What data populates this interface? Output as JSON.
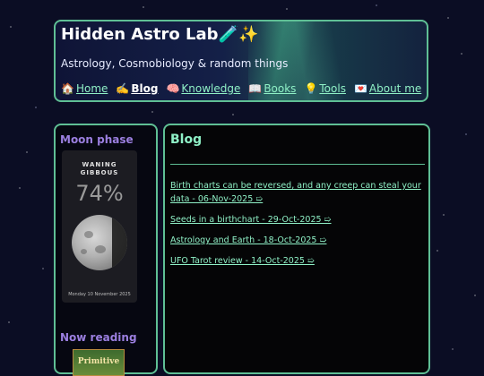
{
  "site": {
    "title": "Hidden Astro Lab",
    "title_emoji": "🧪✨",
    "tagline": "Astrology, Cosmobiology & random things"
  },
  "nav": [
    {
      "icon": "🏠",
      "label": "Home",
      "active": false
    },
    {
      "icon": "✍️",
      "label": "Blog",
      "active": true
    },
    {
      "icon": "🧠",
      "label": "Knowledge",
      "active": false
    },
    {
      "icon": "📖",
      "label": "Books",
      "active": false
    },
    {
      "icon": "💡",
      "label": "Tools",
      "active": false
    },
    {
      "icon": "💌",
      "label": "About me",
      "active": false
    }
  ],
  "sidebar": {
    "moon_title": "Moon phase",
    "moon": {
      "phase_line1": "WANING",
      "phase_line2": "GIBBOUS",
      "illumination": "74%",
      "date": "Monday 10 November 2025"
    },
    "reading_title": "Now reading",
    "book_cover_text": "Primitive"
  },
  "main": {
    "title": "Blog",
    "posts": [
      "Birth charts can be reversed, and any creep can steal your data - 06-Nov-2025 ➯",
      "Seeds in a birthchart - 29-Oct-2025 ➯",
      "Astrology and Earth - 18-Oct-2025 ➯",
      "UFO Tarot review - 14-Oct-2025 ➯"
    ]
  },
  "colors": {
    "accent": "#5fbf95",
    "link": "#8ff0c6",
    "sidebar_heading": "#9b7fe0"
  }
}
